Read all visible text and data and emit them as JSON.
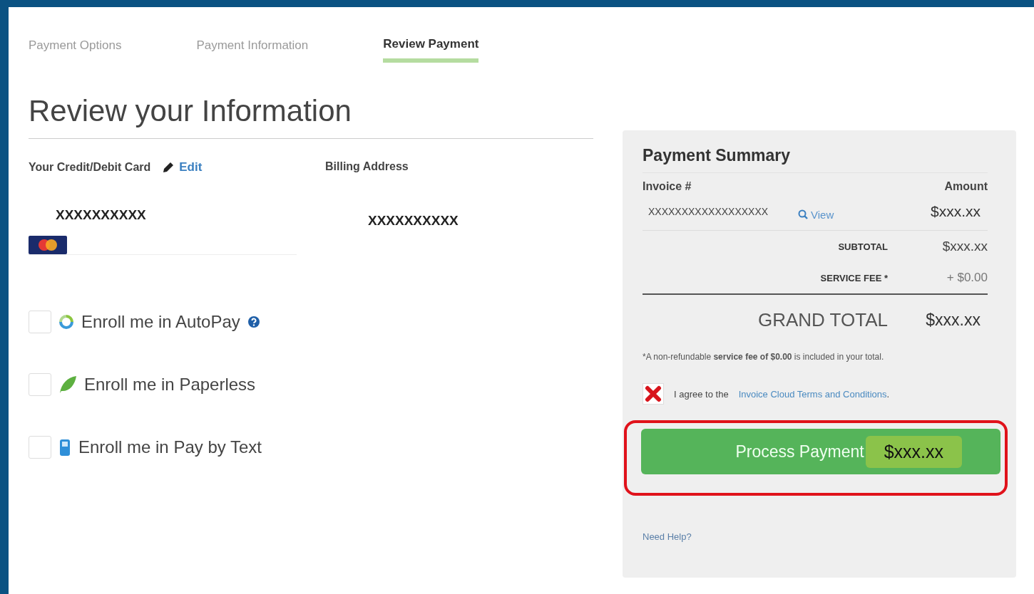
{
  "steps": [
    {
      "label": "Payment Options",
      "selected": false
    },
    {
      "label": "Payment Information",
      "selected": false
    },
    {
      "label": "Review Payment",
      "selected": true
    }
  ],
  "heading": "Review your Information",
  "card": {
    "title": "Your Credit/Debit Card",
    "edit": "Edit",
    "number": "XXXXXXXXXX"
  },
  "billing": {
    "title": "Billing Address",
    "address": "XXXXXXXXXX"
  },
  "enrollments": [
    {
      "kind": "autopay",
      "label": "Enroll me in AutoPay",
      "checked": false,
      "help": true
    },
    {
      "kind": "paperless",
      "label": "Enroll me in Paperless",
      "checked": false,
      "help": false
    },
    {
      "kind": "text",
      "label": "Enroll me in Pay by Text",
      "checked": false,
      "help": false
    }
  ],
  "summary": {
    "title": "Payment Summary",
    "col_invoice": "Invoice #",
    "col_amount": "Amount",
    "invoices": [
      {
        "number": "XXXXXXXXXXXXXXXXXX",
        "view": "View",
        "amount": "$xxx.xx"
      }
    ],
    "subtotal_label": "SUBTOTAL",
    "subtotal": "$xxx.xx",
    "fee_label": "SERVICE FEE *",
    "fee": "+ $0.00",
    "grand_label": "GRAND TOTAL",
    "grand": "$xxx.xx",
    "note": "*A non-refundable **service fee of $0.00** is included in your total.",
    "agree_text": "I agree to the",
    "agree_link": "Invoice Cloud Terms and Conditions",
    "agree_end": ".",
    "agree_error": true,
    "button": {
      "label": "Process Payment",
      "amount": "$xxx.xx",
      "highlighted": true
    },
    "help": "Need Help?"
  }
}
